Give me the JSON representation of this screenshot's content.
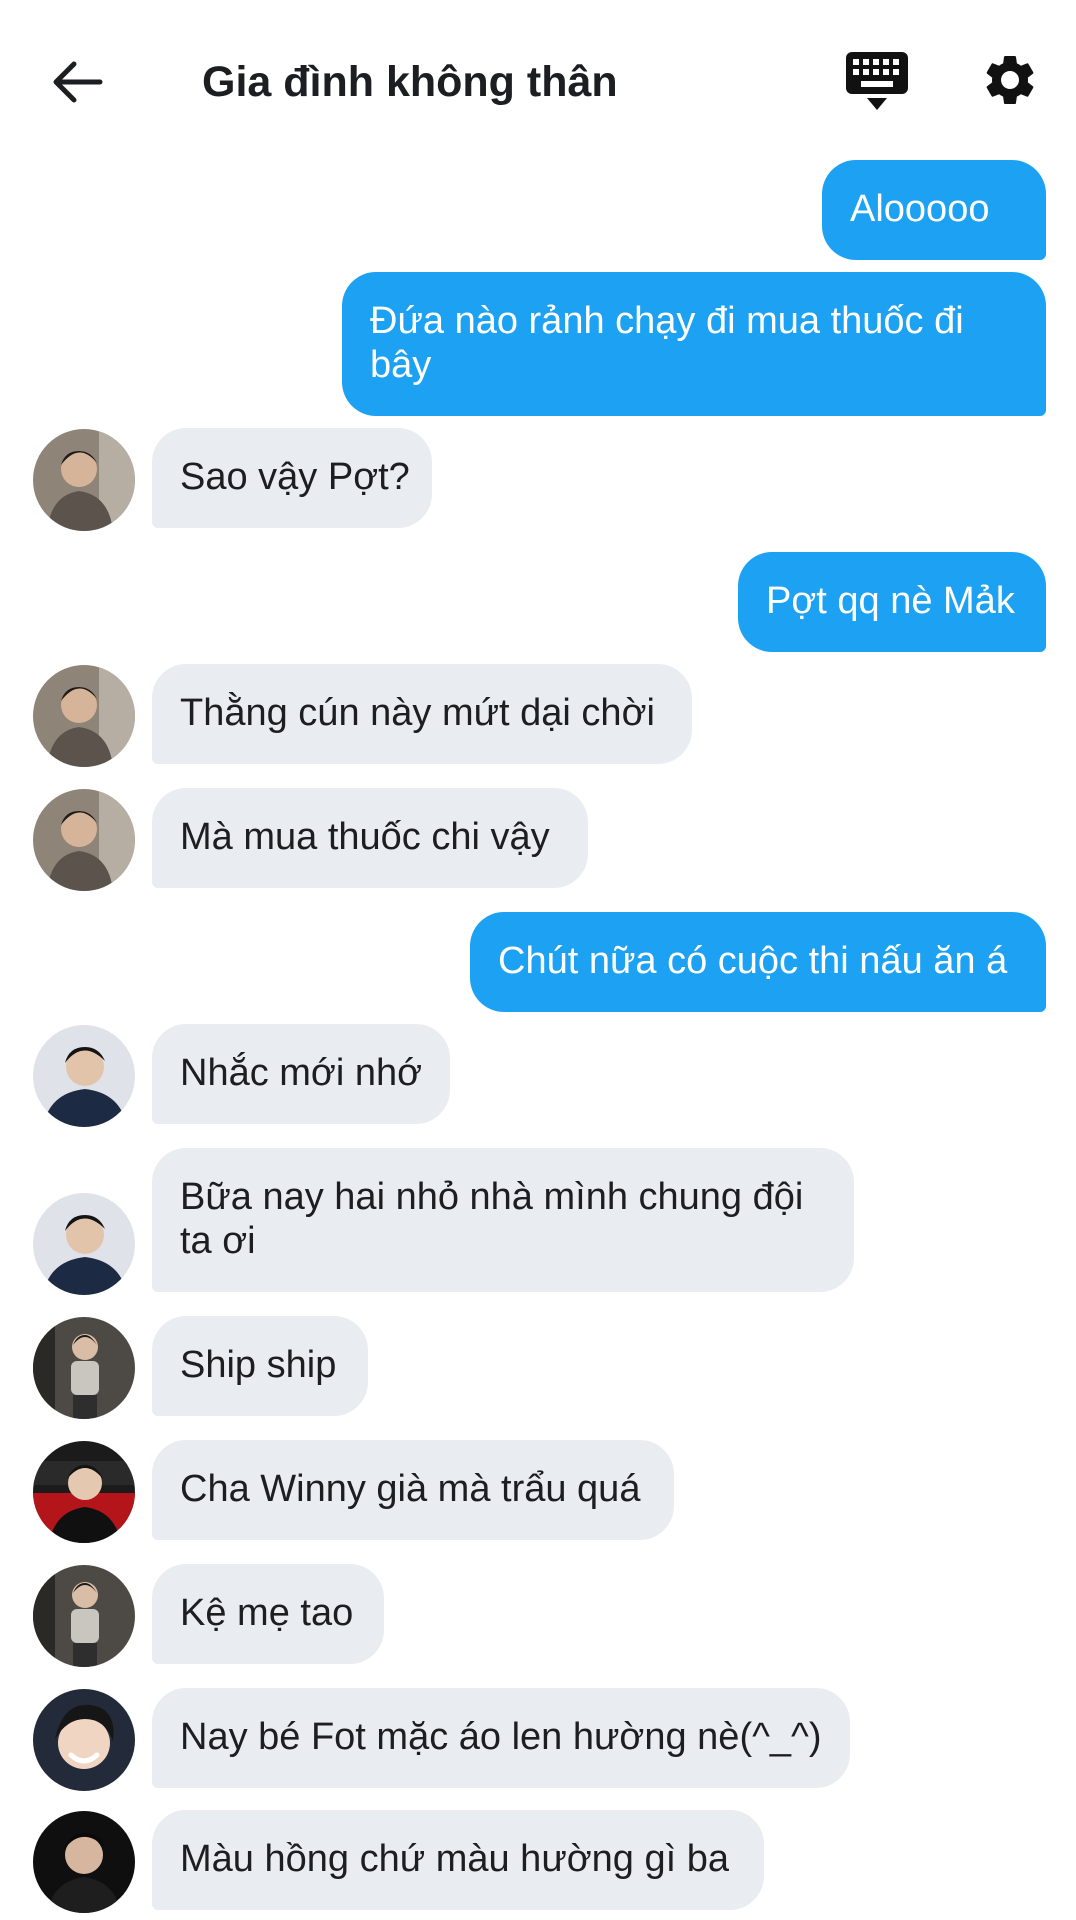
{
  "header": {
    "title": "Gia đình không thân",
    "back_icon": "arrow-left-icon",
    "keyboard_icon": "keyboard-icon",
    "settings_icon": "gear-icon"
  },
  "colors": {
    "outgoing_bubble": "#1da1f2",
    "incoming_bubble": "#e9edf2",
    "text_dark": "#1c1e21"
  },
  "messages": [
    {
      "direction": "out",
      "text": "Alooooo"
    },
    {
      "direction": "out",
      "text": "Đứa nào rảnh chạy đi mua thuốc đi bây"
    },
    {
      "direction": "in",
      "text": "Sao vậy Pợt?"
    },
    {
      "direction": "out",
      "text": "Pợt qq nè Mảk"
    },
    {
      "direction": "in",
      "text": "Thằng cún này mứt dại chời"
    },
    {
      "direction": "in",
      "text": "Mà mua thuốc chi vậy"
    },
    {
      "direction": "out",
      "text": "Chút nữa có cuộc thi nấu ăn á"
    },
    {
      "direction": "in",
      "text": "Nhắc mới nhớ"
    },
    {
      "direction": "in",
      "text": "Bữa nay hai nhỏ nhà mình chung đội ta ơi"
    },
    {
      "direction": "in",
      "text": "Ship ship"
    },
    {
      "direction": "in",
      "text": "Cha Winny già mà trẩu quá"
    },
    {
      "direction": "in",
      "text": "Kệ mẹ tao"
    },
    {
      "direction": "in",
      "text": "Nay bé Fot mặc áo len hường nè(^_^)"
    },
    {
      "direction": "in",
      "text": "Màu hồng chứ màu hường gì ba"
    }
  ]
}
